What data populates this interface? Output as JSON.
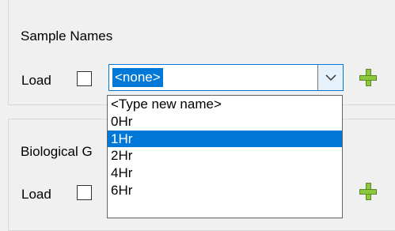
{
  "sample_names": {
    "title": "Sample Names",
    "load_label": "Load",
    "combo_value": "<none>",
    "options": [
      "<Type new name>",
      "0Hr",
      "1Hr",
      "2Hr",
      "4Hr",
      "6Hr"
    ],
    "selected_option": "1Hr"
  },
  "biological_groups": {
    "title_partial": "Biological G",
    "load_label": "Load"
  },
  "colors": {
    "accent": "#0078d7",
    "plus_green": "#8dc63f"
  },
  "icons": {
    "dropdown": "chevron-down-icon",
    "add": "plus-icon"
  }
}
